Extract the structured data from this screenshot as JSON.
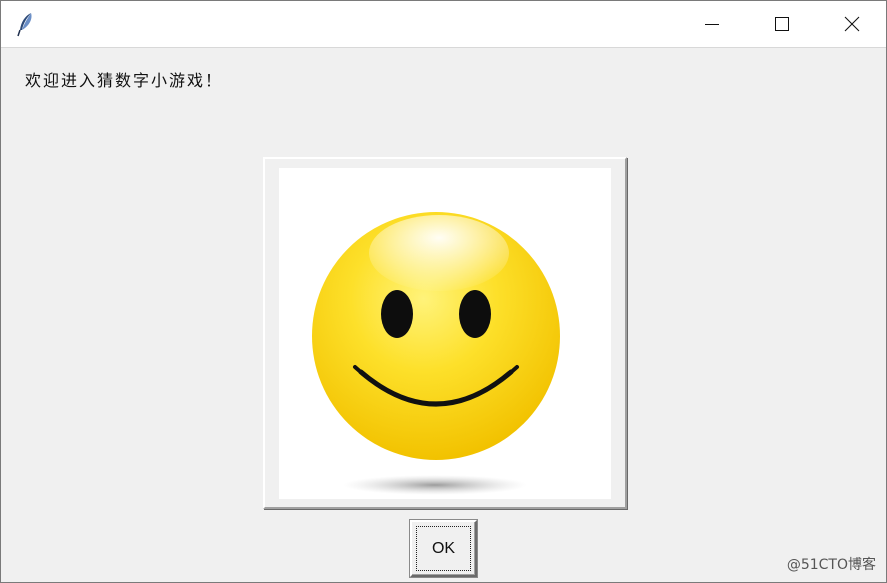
{
  "titlebar": {
    "app_icon": "feather-icon",
    "buttons": {
      "minimize": "minimize-icon",
      "maximize": "maximize-icon",
      "close": "close-icon"
    }
  },
  "main": {
    "message": "欢迎进入猜数字小游戏！",
    "image": {
      "icon": "smiley-face-icon",
      "face_color": "#fad419",
      "feature_color": "#111111"
    },
    "ok_button_label": "OK"
  },
  "watermark": "@51CTO博客"
}
